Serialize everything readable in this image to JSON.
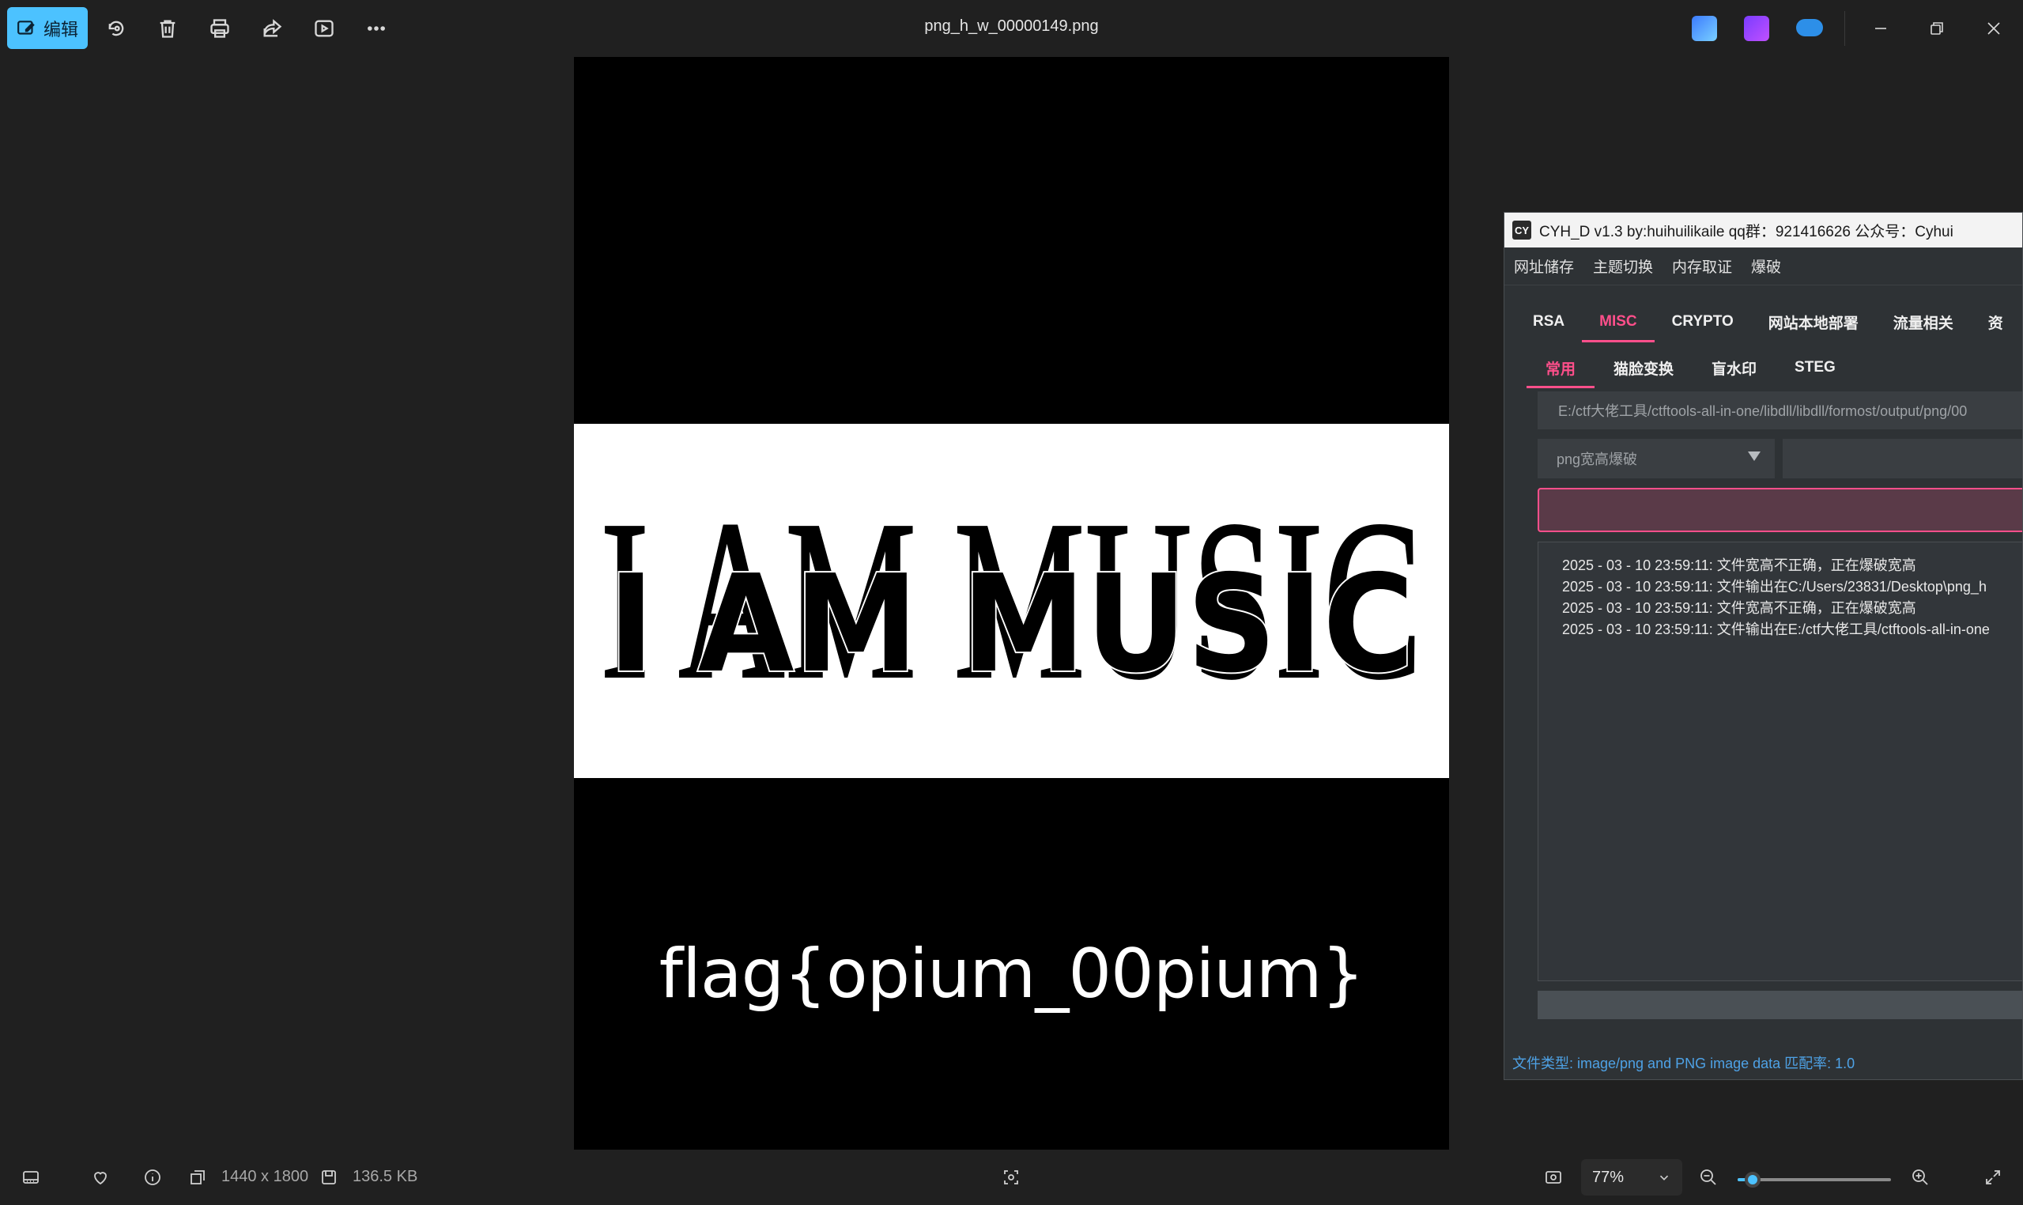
{
  "toolbar": {
    "edit_label": "编辑",
    "icons": [
      "rotate-icon",
      "delete-icon",
      "print-icon",
      "share-icon",
      "slideshow-icon",
      "more-icon"
    ]
  },
  "window": {
    "title": "png_h_w_00000149.png",
    "app_icons": [
      "designer-icon",
      "clipchamp-icon",
      "onedrive-icon"
    ]
  },
  "image": {
    "headline": "I AM MUSIC",
    "flag_text": "flag{opium_00pium}"
  },
  "panel": {
    "title": "CYH_D v1.3 by:huihuilikaile qq群：921416626 公众号：Cyhui",
    "logo": "CY",
    "menu": [
      "网址储存",
      "主题切换",
      "内存取证",
      "爆破"
    ],
    "tabs": [
      "RSA",
      "MISC",
      "CRYPTO",
      "网站本地部署",
      "流量相关",
      "资"
    ],
    "active_tab": "MISC",
    "subtabs": [
      "常用",
      "猫脸变换",
      "盲水印",
      "STEG"
    ],
    "active_subtab": "常用",
    "path": "E:/ctf大佬工具/ctftools-all-in-one/libdll/libdll/formost/output/png/00",
    "select_value": "png宽高爆破",
    "log_lines": [
      "2025 - 03 - 10 23:59:11: 文件宽高不正确，正在爆破宽高",
      "2025 - 03 - 10 23:59:11: 文件输出在C:/Users/23831/Desktop\\png_h",
      "2025 - 03 - 10 23:59:11: 文件宽高不正确，正在爆破宽高",
      "2025 - 03 - 10 23:59:11: 文件输出在E:/ctf大佬工具/ctftools-all-in-one"
    ],
    "status": "文件类型: image/png and PNG image data 匹配率: 1.0"
  },
  "bottombar": {
    "dimensions": "1440 x 1800",
    "file_size": "136.5 KB",
    "zoom": "77%",
    "zoom_slider_fraction": 0.1
  },
  "colors": {
    "accent": "#4cc2ff",
    "panel_accent": "#ff4f8b",
    "status_blue": "#4ea2e6"
  }
}
